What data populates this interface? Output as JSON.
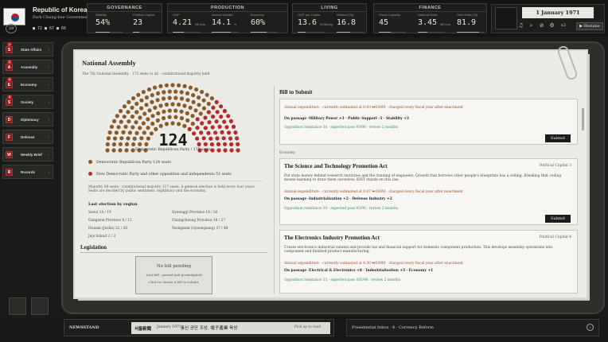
{
  "header": {
    "nation": "Republic of Korea",
    "government": "Park Chung-hee Government",
    "turn": "29",
    "resources": [
      "72",
      "67",
      "66"
    ]
  },
  "panels": [
    {
      "title": "GOVERNANCE",
      "stats": [
        {
          "label": "Stability",
          "value": "54%",
          "fill": 0.54
        },
        {
          "label": "Political Capital",
          "value": "23",
          "fill": 0.23
        }
      ]
    },
    {
      "title": "PRODUCTION",
      "stats": [
        {
          "label": "GDP",
          "value": "4.21",
          "unit": "$B won",
          "fill": 0.4
        },
        {
          "label": "Annual Growth",
          "value": "14.1",
          "unit": "%",
          "fill": 0.7
        },
        {
          "label": "Economy",
          "value": "60%",
          "fill": 0.6
        }
      ]
    },
    {
      "title": "LIVING",
      "stats": [
        {
          "label": "GDP per Capita",
          "value": "13.6",
          "unit": "$10k/cap",
          "fill": 0.3
        },
        {
          "label": "Inflation (%)",
          "value": "16.8",
          "fill": 0.5
        }
      ]
    },
    {
      "title": "FINANCE",
      "stats": [
        {
          "label": "Fiscal Capacity",
          "value": "45",
          "fill": 0.45
        },
        {
          "label": "National Debt",
          "value": "3.45",
          "unit": "$B won",
          "fill": 0.35
        },
        {
          "label": "Debt Ratio (%)",
          "value": "81.9",
          "fill": 0.82
        }
      ]
    }
  ],
  "date": "1 January 1971",
  "speed": "x2",
  "resume": "Resume",
  "sidebar": {
    "items": [
      {
        "label": "State Affairs",
        "icon": "S",
        "badge": "1"
      },
      {
        "label": "Assembly",
        "icon": "A",
        "badge": "2"
      },
      {
        "label": "Economy",
        "icon": "E",
        "badge": "3"
      },
      {
        "label": "Society",
        "icon": "S",
        "badge": "4"
      },
      {
        "label": "Diplomacy",
        "icon": "D",
        "badge": ""
      },
      {
        "label": "Defense",
        "icon": "F",
        "badge": ""
      },
      {
        "label": "Weekly Brief",
        "icon": "W",
        "badge": ""
      },
      {
        "label": "Records",
        "icon": "R",
        "badge": ""
      }
    ]
  },
  "assembly": {
    "title": "National Assembly",
    "subtitle": "The 7th National Assembly · 175 seats in all · constitutional majority held",
    "seats": "124",
    "seats_caption": "Democratic Republican Party / 175 seats",
    "legend": [
      {
        "label": "Democratic Republican Party 124 seats",
        "color": "#8a5a2b"
      },
      {
        "label": "New Democratic Party and other opposition and independents 51 seats",
        "color": "#b52a2a"
      }
    ],
    "note": "Majority 88 seats · constitutional majority 117 seats. A general election is held every four years. Seats are decided by public sentiment, legitimacy and the economy.",
    "region_title": "Last election by region",
    "regions": [
      [
        "Seoul 14 / 19",
        "Gyeonggi Province 18 / 26"
      ],
      [
        "Gangwon Province 8 / 12",
        "Chungcheong Province 18 / 27"
      ],
      [
        "Honam (Jeolla) 22 / 36",
        "Yeongnam (Gyeongsang) 37 / 48"
      ],
      [
        "Jeju Island 2 / 3",
        ""
      ]
    ],
    "legislation_title": "Legislation",
    "nobill": {
      "title": "No bill pending",
      "l1": "Last bill · passed and promulgated",
      "l2": "Click to choose a bill to submit."
    }
  },
  "bills_header": "Bill to Submit",
  "bills": [
    {
      "annual": "Annual expenditure · currently estimated at 0.43 ₩100M · charged every fiscal year after enactment",
      "passage": "On passage ·Military Power +3 · Public Support -5 · Stability +3",
      "opp": "Opposition resistance 36 · expected pass 93/96 · review 2 months",
      "submit": "Submit"
    },
    {
      "category": "Economy",
      "title": "The Science and Technology Promotion Act",
      "pc": "Political Capital 3",
      "desc": "Put state money behind research institutes and the training of engineers. Growth that borrows other people's blueprints has a ceiling. Breaking that ceiling means learning to draw them ourselves. KIST stands on this law.",
      "annual": "Annual expenditure · currently estimated at 0.07 ₩100M · charged every fiscal year after enactment",
      "passage": "On passage ·Industrialization +2 · Defense Industry +2",
      "opp": "Opposition resistance 10 · expected pass 93/96 · review 2 months",
      "submit": "Submit"
    },
    {
      "title": "The Electronics Industry Promotion Act",
      "pc": "Political Capital 4",
      "desc": "Create electronics industrial estates and provide tax and financial support for domestic component production. This develops assembly operations into component and finished-product manufacturing.",
      "annual": "Annual expenditure · currently estimated at 0.30 ₩100M · charged every fiscal year after enactment",
      "passage": "On passage ·Electrical & Electronics +8 · Industrialization +3 · Economy +1",
      "opp": "Opposition resistance 15 · expected pass 105/96 · review 2 months"
    }
  ],
  "newsstand": {
    "label": "NEWSSTAND",
    "paper": "서울新聞",
    "date": "January 1971",
    "headline": "통신 공단 조성, 電子產業 육성",
    "action": "Pick up to read"
  },
  "inbox": {
    "text": "Presidential Inbox · 4 · Currency Reform"
  }
}
